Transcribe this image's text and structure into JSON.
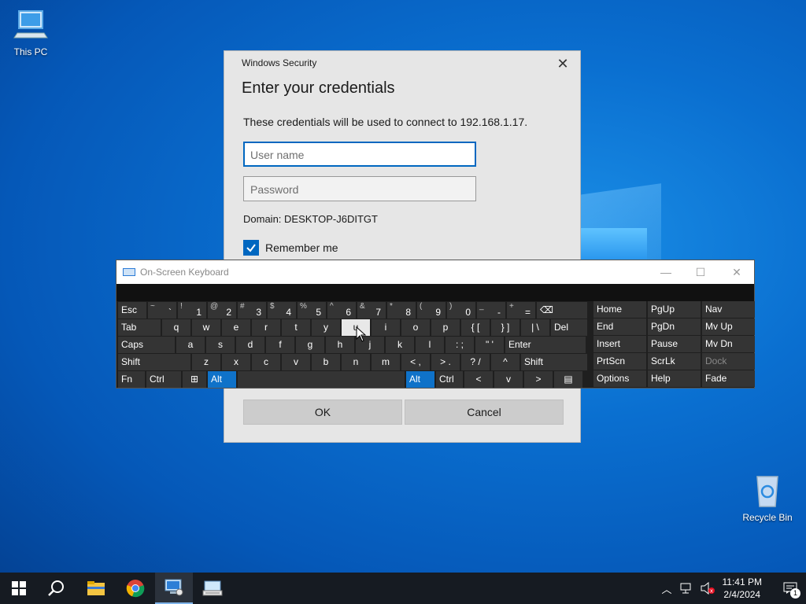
{
  "desktop": {
    "icons": [
      {
        "label": "This PC"
      },
      {
        "label": "Recycle Bin"
      }
    ]
  },
  "dialog": {
    "app_title": "Windows Security",
    "heading": "Enter your credentials",
    "description": "These credentials will be used to connect to 192.168.1.17.",
    "username_placeholder": "User name",
    "password_placeholder": "Password",
    "domain": "Domain: DESKTOP-J6DITGT",
    "remember_label": "Remember me",
    "remember_checked": true,
    "ok_label": "OK",
    "cancel_label": "Cancel"
  },
  "osk": {
    "title": "On-Screen Keyboard",
    "row1": [
      {
        "sub": "",
        "main": "Esc"
      },
      {
        "sub": "~",
        "main": "`"
      },
      {
        "sub": "!",
        "main": "1"
      },
      {
        "sub": "@",
        "main": "2"
      },
      {
        "sub": "#",
        "main": "3"
      },
      {
        "sub": "$",
        "main": "4"
      },
      {
        "sub": "%",
        "main": "5"
      },
      {
        "sub": "^",
        "main": "6"
      },
      {
        "sub": "&",
        "main": "7"
      },
      {
        "sub": "*",
        "main": "8"
      },
      {
        "sub": "(",
        "main": "9"
      },
      {
        "sub": ")",
        "main": "0"
      },
      {
        "sub": "_",
        "main": "-"
      },
      {
        "sub": "+",
        "main": "="
      },
      {
        "sub": "",
        "main": "⌫"
      }
    ],
    "row2": [
      "Tab",
      "q",
      "w",
      "e",
      "r",
      "t",
      "y",
      "u",
      "i",
      "o",
      "p",
      "{ [",
      "} ]",
      "| \\",
      "Del"
    ],
    "row3": [
      "Caps",
      "a",
      "s",
      "d",
      "f",
      "g",
      "h",
      "j",
      "k",
      "l",
      ": ;",
      "\" '",
      "Enter"
    ],
    "row4": [
      "Shift",
      "z",
      "x",
      "c",
      "v",
      "b",
      "n",
      "m",
      "< ,",
      "> .",
      "? /",
      "^",
      "Shift"
    ],
    "row5": [
      "Fn",
      "Ctrl",
      "⊞",
      "Alt",
      "",
      "Alt",
      "Ctrl",
      "<",
      "v",
      ">",
      "▤"
    ],
    "nav": [
      [
        "Home",
        "PgUp",
        "Nav"
      ],
      [
        "End",
        "PgDn",
        "Mv Up"
      ],
      [
        "Insert",
        "Pause",
        "Mv Dn"
      ],
      [
        "PrtScn",
        "ScrLk",
        "Dock"
      ],
      [
        "Options",
        "Help",
        "Fade"
      ]
    ]
  },
  "taskbar": {
    "time": "11:41 PM",
    "date": "2/4/2024",
    "notification_count": "1"
  }
}
